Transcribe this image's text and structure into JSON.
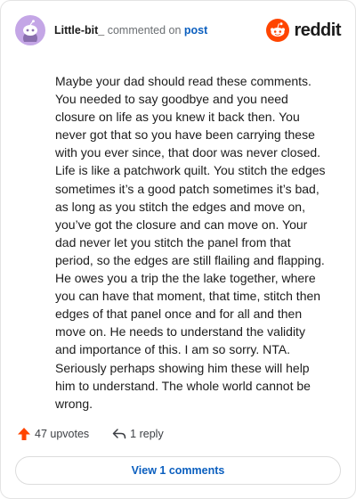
{
  "comment": {
    "username": "Little-bit_",
    "action_text": "commented on",
    "target_link": "post",
    "body": "Maybe your dad should read these comments. You needed to say goodbye and you need closure on life as you knew it back then. You never got that so you have been carrying these with you ever since, that door was never closed. Life is like a patchwork quilt. You stitch the edges sometimes it’s a good patch sometimes it’s bad, as long as you stitch the edges and move on, you’ve got the closure and can move on. Your dad never let you stitch the panel from that period, so the edges are still flailing and flapping. He owes you a trip the the lake together, where you can have that moment, that time, stitch then edges of that panel once and for all and then move on. He needs to understand the validity and importance of this. I am so sorry. NTA. Seriously perhaps showing him these will help him to understand. The whole world cannot be wrong."
  },
  "brand": {
    "wordmark": "reddit",
    "accent_color": "#ff4500"
  },
  "footer": {
    "upvotes_label": "47 upvotes",
    "reply_label": "1 reply",
    "view_comments_label": "View 1 comments",
    "upvote_icon": "arrow-up-icon",
    "reply_icon": "reply-arrow-icon"
  },
  "colors": {
    "link": "#0b5fbf",
    "avatar_bg": "#c4a6e6"
  }
}
